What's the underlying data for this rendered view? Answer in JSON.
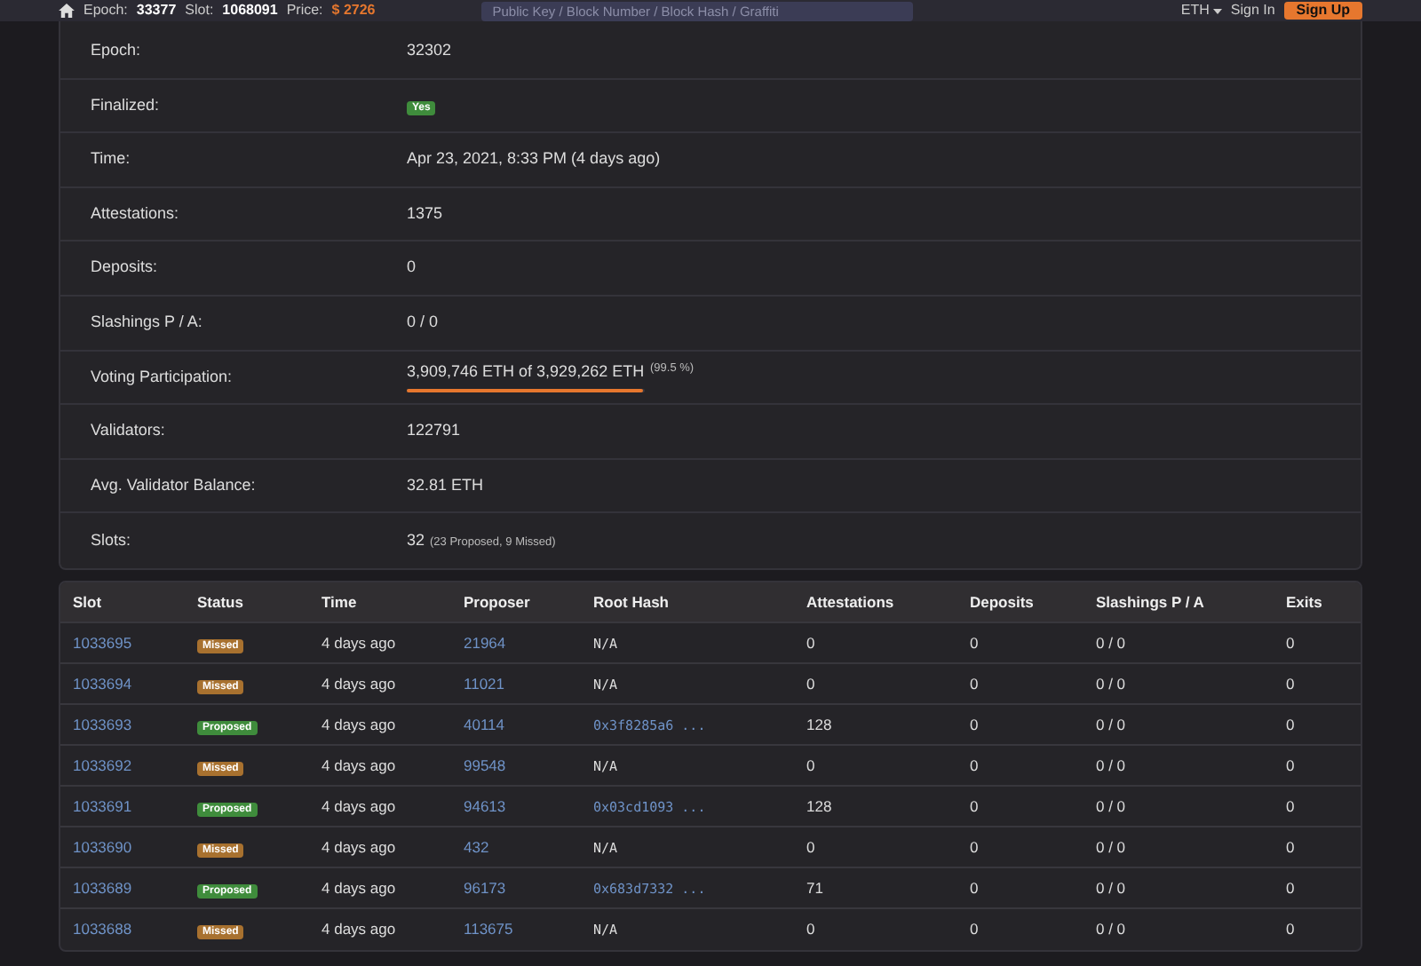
{
  "navbar": {
    "epoch_label": "Epoch:",
    "epoch": "33377",
    "slot_label": "Slot:",
    "slot": "1068091",
    "price_label": "Price:",
    "price": "$ 2726",
    "search": {
      "placeholder": "Public Key / Block Number / Block Hash / Graffiti"
    },
    "currency": "ETH",
    "sign_in": "Sign In",
    "sign_up": "Sign Up"
  },
  "details": [
    {
      "label": "Epoch:",
      "value": "32302"
    },
    {
      "label": "Finalized:",
      "badge": "Yes",
      "kind": "badge"
    },
    {
      "label": "Time:",
      "value": "Apr 23, 2021, 8:33 PM (4 days ago)"
    },
    {
      "label": "Attestations:",
      "value": "1375"
    },
    {
      "label": "Deposits:",
      "value": "0"
    },
    {
      "label": "Slashings P / A:",
      "value": "0 / 0"
    },
    {
      "label": "Voting Participation:",
      "value": "3,909,746 ETH of 3,929,262 ETH",
      "note": "(99.5 %)",
      "level": 0.995,
      "kind": "progress"
    },
    {
      "label": "Validators:",
      "value": "122791"
    },
    {
      "label": "Avg. Validator Balance:",
      "value": "32.81 ETH"
    },
    {
      "label": "Slots:",
      "value": "32",
      "note": "(23 Proposed, 9 Missed)"
    }
  ],
  "table": {
    "columns": [
      "Slot",
      "Status",
      "Time",
      "Proposer",
      "Root Hash",
      "Attestations",
      "Deposits",
      "Slashings P / A",
      "Exits"
    ],
    "rows": [
      {
        "slot": "1033695",
        "status": "Missed",
        "kind": "missed",
        "time": "4 days ago",
        "proposer": "21964",
        "root_hash": "N/A",
        "attestations": "0",
        "deposits": "0",
        "slashings": "0 / 0",
        "exits": "0"
      },
      {
        "slot": "1033694",
        "status": "Missed",
        "kind": "missed",
        "time": "4 days ago",
        "proposer": "11021",
        "root_hash": "N/A",
        "attestations": "0",
        "deposits": "0",
        "slashings": "0 / 0",
        "exits": "0"
      },
      {
        "slot": "1033693",
        "status": "Proposed",
        "kind": "proposed",
        "time": "4 days ago",
        "proposer": "40114",
        "root_hash": "0x3f8285a6 ...",
        "attestations": "128",
        "deposits": "0",
        "slashings": "0 / 0",
        "exits": "0"
      },
      {
        "slot": "1033692",
        "status": "Missed",
        "kind": "missed",
        "time": "4 days ago",
        "proposer": "99548",
        "root_hash": "N/A",
        "attestations": "0",
        "deposits": "0",
        "slashings": "0 / 0",
        "exits": "0"
      },
      {
        "slot": "1033691",
        "status": "Proposed",
        "kind": "proposed",
        "time": "4 days ago",
        "proposer": "94613",
        "root_hash": "0x03cd1093 ...",
        "attestations": "128",
        "deposits": "0",
        "slashings": "0 / 0",
        "exits": "0"
      },
      {
        "slot": "1033690",
        "status": "Missed",
        "kind": "missed",
        "time": "4 days ago",
        "proposer": "432",
        "root_hash": "N/A",
        "attestations": "0",
        "deposits": "0",
        "slashings": "0 / 0",
        "exits": "0"
      },
      {
        "slot": "1033689",
        "status": "Proposed",
        "kind": "proposed",
        "time": "4 days ago",
        "proposer": "96173",
        "root_hash": "0x683d7332 ...",
        "attestations": "71",
        "deposits": "0",
        "slashings": "0 / 0",
        "exits": "0"
      },
      {
        "slot": "1033688",
        "status": "Missed",
        "kind": "missed",
        "time": "4 days ago",
        "proposer": "113675",
        "root_hash": "N/A",
        "attestations": "0",
        "deposits": "0",
        "slashings": "0 / 0",
        "exits": "0"
      }
    ]
  }
}
